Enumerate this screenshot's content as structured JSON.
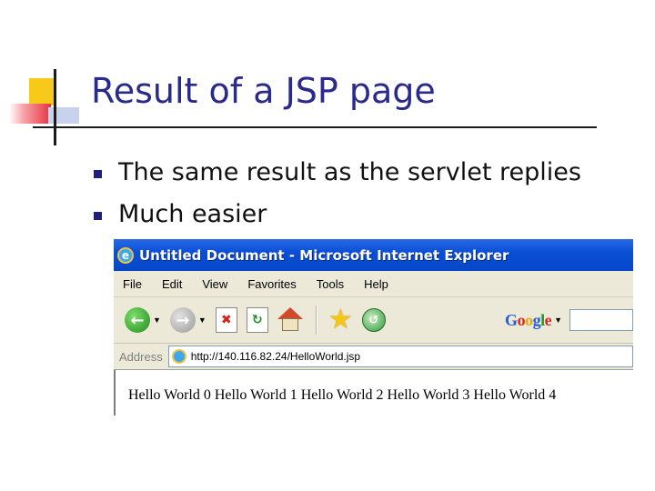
{
  "slide": {
    "title": "Result of a JSP page",
    "bullets": [
      "The same result as the servlet replies",
      "Much easier"
    ]
  },
  "browser": {
    "window_title": "Untitled Document - Microsoft Internet Explorer",
    "menu": [
      "File",
      "Edit",
      "View",
      "Favorites",
      "Tools",
      "Help"
    ],
    "toolbar_icons": [
      "back-icon",
      "forward-icon",
      "stop-icon",
      "refresh-icon",
      "home-icon",
      "favorites-star-icon",
      "history-icon"
    ],
    "search_engine": "Google",
    "address_label": "Address",
    "address_url": "http://140.116.82.24/HelloWorld.jsp",
    "page_content": "Hello World 0 Hello World 1 Hello World 2 Hello World 3 Hello World 4"
  },
  "colors": {
    "title": "#2a2a8c",
    "titlebar": "#0a4fd6",
    "chrome": "#ece9d8"
  }
}
